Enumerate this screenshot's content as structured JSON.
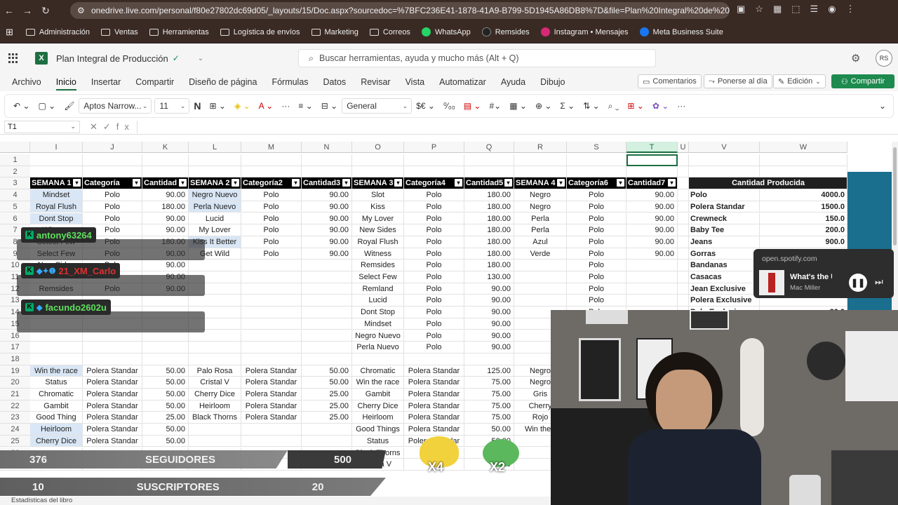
{
  "browser": {
    "url": "onedrive.live.com/personal/f80e27802dc69d05/_layouts/15/Doc.aspx?sourcedoc=%7BFC236E41-1878-41A9-B799-5D1945A86DB8%7D&file=Plan%20Integral%20de%20Produ...",
    "bookmarks": [
      "Administración",
      "Ventas",
      "Herramientas",
      "Logística de envíos",
      "Marketing",
      "Correos",
      "WhatsApp",
      "Remsides",
      "Instagram • Mensajes",
      "Meta Business Suite"
    ]
  },
  "excel": {
    "doc_title": "Plan Integral de Producción",
    "search_placeholder": "Buscar herramientas, ayuda y mucho más (Alt + Q)",
    "avatar": "RS",
    "menu": [
      "Archivo",
      "Inicio",
      "Insertar",
      "Compartir",
      "Diseño de página",
      "Fórmulas",
      "Datos",
      "Revisar",
      "Vista",
      "Automatizar",
      "Ayuda",
      "Dibujo"
    ],
    "comments_label": "Comentarios",
    "catchup_label": "Ponerse al día",
    "edit_label": "Edición",
    "share_label": "Compartir",
    "font_name": "Aptos Narrow...",
    "font_size": "11",
    "number_format": "General",
    "name_box": "T1",
    "status_text": "Estadísticas del libro"
  },
  "columns": [
    "I",
    "J",
    "K",
    "L",
    "M",
    "N",
    "O",
    "P",
    "Q",
    "R",
    "S",
    "T",
    "U",
    "V",
    "W"
  ],
  "rows": [
    "1",
    "2",
    "3",
    "4",
    "5",
    "6",
    "7",
    "8",
    "9",
    "10",
    "11",
    "12",
    "13",
    "14",
    "15",
    "16",
    "17",
    "18",
    "19",
    "20",
    "21",
    "22",
    "23",
    "24",
    "25",
    "26",
    "27"
  ],
  "headers": [
    "SEMANA 1",
    "Categoría",
    "Cantidad",
    "SEMANA 2",
    "Categoría2",
    "Cantidad3",
    "SEMANA 3",
    "Categoría4",
    "Cantidad5",
    "SEMANA 4",
    "Categoría6",
    "Cantidad7"
  ],
  "table_rows": [
    [
      "Mindset",
      "Polo",
      "90.00",
      "Negro Nuevo",
      "Polo",
      "90.00",
      "Slot",
      "Polo",
      "180.00",
      "Negro",
      "Polo",
      "90.00"
    ],
    [
      "Royal Flush",
      "Polo",
      "180.00",
      "Perla Nuevo",
      "Polo",
      "90.00",
      "Kiss",
      "Polo",
      "180.00",
      "Negro",
      "Polo",
      "90.00"
    ],
    [
      "Dont Stop",
      "Polo",
      "90.00",
      "Lucid",
      "Polo",
      "90.00",
      "My Lover",
      "Polo",
      "180.00",
      "Perla",
      "Polo",
      "90.00"
    ],
    [
      "Witness",
      "Polo",
      "90.00",
      "My Lover",
      "Polo",
      "90.00",
      "New Sides",
      "Polo",
      "180.00",
      "Perla",
      "Polo",
      "90.00"
    ],
    [
      "Select Few",
      "Polo",
      "180.00",
      "Kiss It Better",
      "Polo",
      "90.00",
      "Royal Flush",
      "Polo",
      "180.00",
      "Azul",
      "Polo",
      "90.00"
    ],
    [
      "Select Few",
      "Polo",
      "90.00",
      "Get Wild",
      "Polo",
      "90.00",
      "Witness",
      "Polo",
      "180.00",
      "Verde",
      "Polo",
      "90.00"
    ],
    [
      "New Sides",
      "Polo",
      "90.00",
      "",
      "",
      "",
      "Remsides",
      "Polo",
      "180.00",
      "",
      "Polo",
      ""
    ],
    [
      "",
      "",
      "90.00",
      "",
      "",
      "",
      "Select Few",
      "Polo",
      "130.00",
      "",
      "Polo",
      ""
    ],
    [
      "Remsides",
      "Polo",
      "90.00",
      "",
      "",
      "",
      "Remland",
      "Polo",
      "90.00",
      "",
      "Polo",
      ""
    ],
    [
      "",
      "",
      "",
      "",
      "",
      "",
      "Lucid",
      "Polo",
      "90.00",
      "",
      "Polo",
      ""
    ],
    [
      "",
      "",
      "",
      "",
      "",
      "",
      "Dont Stop",
      "Polo",
      "90.00",
      "",
      "Polo",
      ""
    ],
    [
      "",
      "",
      "",
      "",
      "",
      "",
      "Mindset",
      "Polo",
      "90.00",
      "",
      "",
      ""
    ],
    [
      "",
      "",
      "",
      "",
      "",
      "",
      "Negro Nuevo",
      "Polo",
      "90.00",
      "",
      "",
      ""
    ],
    [
      "",
      "",
      "",
      "",
      "",
      "",
      "Perla Nuevo",
      "Polo",
      "90.00",
      "",
      "",
      ""
    ],
    [
      "",
      "",
      "",
      "",
      "",
      "",
      "",
      "",
      "",
      "",
      "",
      ""
    ],
    [
      "Win the race",
      "Polera Standar",
      "50.00",
      "Palo Rosa",
      "Polera Standar",
      "50.00",
      "Chromatic",
      "Polera Standar",
      "125.00",
      "Negro",
      "",
      ""
    ],
    [
      "Status",
      "Polera Standar",
      "50.00",
      "Cristal V",
      "Polera Standar",
      "50.00",
      "Win the race",
      "Polera Standar",
      "75.00",
      "Negro",
      "",
      ""
    ],
    [
      "Chromatic",
      "Polera Standar",
      "50.00",
      "Cherry Dice",
      "Polera Standar",
      "25.00",
      "Gambit",
      "Polera Standar",
      "75.00",
      "Gris",
      "",
      ""
    ],
    [
      "Gambit",
      "Polera Standar",
      "50.00",
      "Heirloom",
      "Polera Standar",
      "25.00",
      "Cherry Dice",
      "Polera Standar",
      "75.00",
      "Cherry",
      "",
      ""
    ],
    [
      "Good Thing",
      "Polera Standar",
      "25.00",
      "Black Thorns",
      "Polera Standar",
      "25.00",
      "Heirloom",
      "Polera Standar",
      "75.00",
      "Rojo",
      "",
      ""
    ],
    [
      "Heirloom",
      "Polera Standar",
      "50.00",
      "",
      "",
      "",
      "Good Things",
      "Polera Standar",
      "50.00",
      "Win the r",
      "",
      ""
    ],
    [
      "Cherry Dice",
      "Polera Standar",
      "50.00",
      "",
      "",
      "",
      "Status",
      "Polera Standar",
      "50.00",
      "",
      "",
      ""
    ],
    [
      "",
      "",
      "",
      "",
      "",
      "",
      "Black Thorns",
      "Polera",
      "50.00",
      "",
      "",
      ""
    ],
    [
      "",
      "",
      "",
      "",
      "",
      "",
      "Crista V",
      "",
      "50.00",
      "",
      "",
      ""
    ]
  ],
  "summary": {
    "header": "Cantidad Producida",
    "items": [
      [
        "Polo",
        "4000.0"
      ],
      [
        "Polera Standar",
        "1500.0"
      ],
      [
        "Crewneck",
        "150.0"
      ],
      [
        "Baby Tee",
        "200.0"
      ],
      [
        "Jeans",
        "900.0"
      ],
      [
        "Gorras",
        "60.0"
      ],
      [
        "Bandanas",
        ""
      ],
      [
        "Casacas",
        ""
      ],
      [
        "Jean Exclusive",
        ""
      ],
      [
        "Polera Exclusive",
        ""
      ],
      [
        "Polo Exclusive",
        "80.0"
      ]
    ]
  },
  "overlay": {
    "chat": [
      {
        "user": "antony63264",
        "color": "#5ee05e"
      },
      {
        "user": "21_XM_Carlo",
        "color": "#e03030"
      },
      {
        "user": "facundo2602u",
        "color": "#5ee05e"
      }
    ],
    "spotify": {
      "source": "open.spotify.com",
      "title": "What's the U",
      "artist": "Mac Miller"
    },
    "followers": {
      "current": "376",
      "label": "SEGUIDORES",
      "goal": "500"
    },
    "subscribers": {
      "current": "10",
      "label": "SUSCRIPTORES",
      "goal": "20"
    },
    "multipliers": [
      "X4",
      "X2"
    ]
  }
}
